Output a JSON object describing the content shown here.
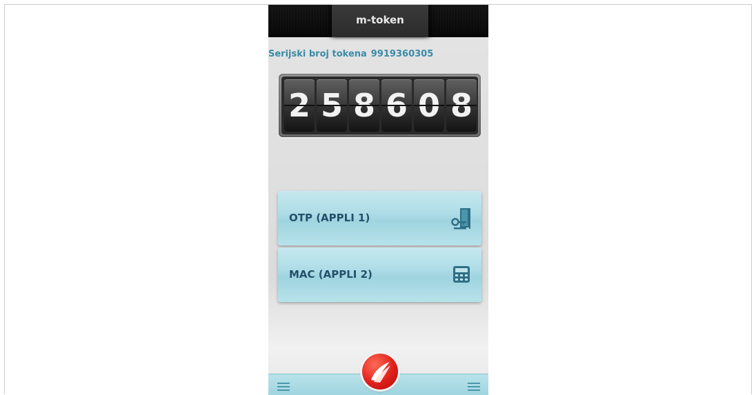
{
  "app": {
    "title": "m-token"
  },
  "serial": {
    "label": "Serijski broj tokena",
    "value": "9919360305"
  },
  "token": {
    "digits": [
      "2",
      "5",
      "8",
      "6",
      "0",
      "8"
    ]
  },
  "buttons": [
    {
      "label": "OTP (APPLI 1)",
      "icon": "door-key-icon"
    },
    {
      "label": "MAC (APPLI 2)",
      "icon": "calculator-icon"
    }
  ],
  "footer": {
    "left_icon": "menu-icon",
    "center_icon": "bank-logo-icon",
    "right_icon": "menu-icon"
  },
  "colors": {
    "accent": "#3a8ba8",
    "card": "#aedde7",
    "header": "#2d2d2d",
    "logo": "#e0201b"
  }
}
